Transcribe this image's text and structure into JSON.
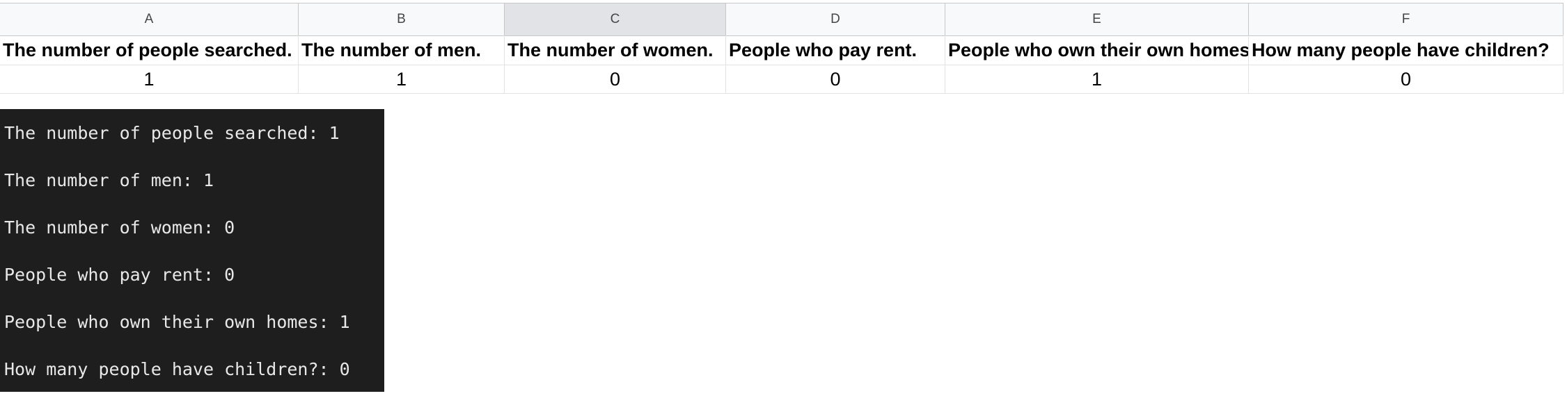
{
  "spreadsheet": {
    "columns": [
      "A",
      "B",
      "C",
      "D",
      "E",
      "F"
    ],
    "selected_column": "C",
    "headers": [
      "The number of people searched.",
      "The number of men.",
      "The number of women.",
      "People who pay rent.",
      "People who own their own homes",
      "How many people have children?"
    ],
    "values": [
      "1",
      "1",
      "0",
      "0",
      "1",
      "0"
    ]
  },
  "terminal": {
    "lines": [
      "The number of people searched: 1",
      "The number of men: 1",
      "The number of women: 0",
      "People who pay rent: 0",
      "People who own their own homes: 1",
      "How many people have children?: 0"
    ]
  }
}
